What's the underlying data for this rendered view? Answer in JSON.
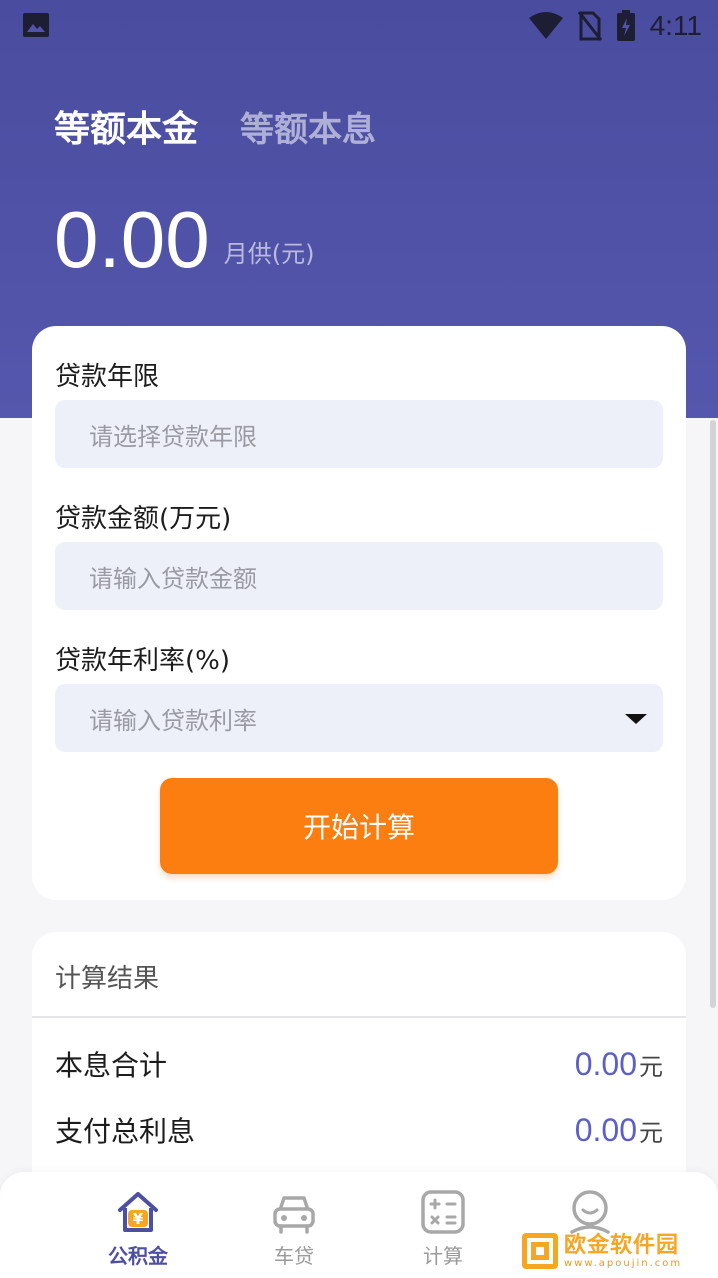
{
  "status_bar": {
    "time": "4:11"
  },
  "tabs": [
    {
      "label": "等额本金",
      "active": true
    },
    {
      "label": "等额本息",
      "active": false
    }
  ],
  "payment": {
    "amount": "0.00",
    "unit": "月供(元)"
  },
  "form": {
    "term": {
      "label": "贷款年限",
      "placeholder": "请选择贷款年限"
    },
    "amount": {
      "label": "贷款金额(万元)",
      "placeholder": "请输入贷款金额"
    },
    "rate": {
      "label": "贷款年利率(%)",
      "placeholder": "请输入贷款利率"
    },
    "submit_label": "开始计算"
  },
  "result": {
    "title": "计算结果",
    "rows": [
      {
        "label": "本息合计",
        "value": "0.00",
        "unit": "元"
      },
      {
        "label": "支付总利息",
        "value": "0.00",
        "unit": "元"
      }
    ]
  },
  "nav": [
    {
      "label": "公积金",
      "icon": "house-yen-icon",
      "active": true
    },
    {
      "label": "车贷",
      "icon": "car-icon",
      "active": false
    },
    {
      "label": "计算",
      "icon": "calculator-icon",
      "active": false
    },
    {
      "label": "",
      "icon": "profile-icon",
      "active": false
    }
  ],
  "watermark": {
    "main": "欧金软件园",
    "sub": "www.apoujin.com"
  },
  "colors": {
    "header": "#5154a8",
    "accent_button": "#fc7d10",
    "result_value": "#5b5fc7",
    "nav_active": "#4d4fa3"
  }
}
